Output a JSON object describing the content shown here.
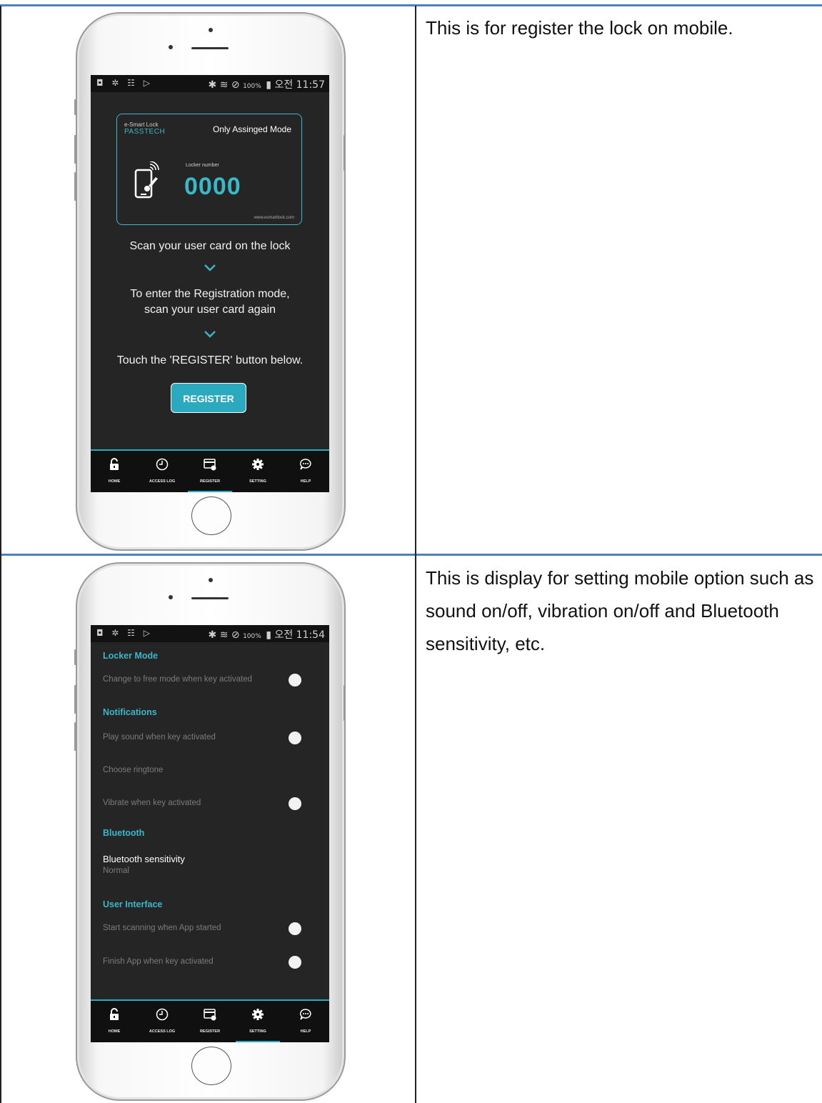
{
  "rows": [
    {
      "description": "This is for register the lock on mobile.",
      "screen": {
        "status": {
          "left_icons": "◘ ✲ ☷ ▷",
          "right_icons": "✱ ≋ ⊘",
          "battery": "100%",
          "time": "오전 11:57"
        },
        "card": {
          "brand_small": "e-Smart Lock",
          "brand_big": "PASSTECH",
          "mode_title": "Only Assinged Mode",
          "locker_label": "Locker number",
          "locker_number": "0000",
          "website": "www.esmartlock.com"
        },
        "instructions": {
          "step1": "Scan your user card on the lock",
          "step2_line1": "To enter the Registration mode,",
          "step2_line2": "scan your user card again",
          "step3": "Touch the 'REGISTER' button below."
        },
        "register_button": "REGISTER",
        "nav": [
          {
            "label": "HOME",
            "icon": "lock-icon"
          },
          {
            "label": "ACCESS LOG",
            "icon": "clock-icon"
          },
          {
            "label": "REGISTER",
            "icon": "card-icon",
            "active": true
          },
          {
            "label": "SETTING",
            "icon": "gear-icon"
          },
          {
            "label": "HELP",
            "icon": "chat-bubble-icon"
          }
        ]
      }
    },
    {
      "description": "This is display for setting mobile option such as sound on/off, vibration on/off and Bluetooth sensitivity, etc.",
      "screen": {
        "status": {
          "left_icons": "◘ ✲ ☷ ▷",
          "right_icons": "✱ ≋ ⊘",
          "battery": "100%",
          "time": "오전 11:54"
        },
        "settings": {
          "locker_mode_header": "Locker Mode",
          "free_mode_label": "Change to free mode when key activated",
          "notifications_header": "Notifications",
          "play_sound_label": "Play sound when key activated",
          "ringtone_label": "Choose ringtone",
          "vibrate_label": "Vibrate when key activated",
          "bluetooth_header": "Bluetooth",
          "bt_sensitivity_title": "Bluetooth sensitivity",
          "bt_sensitivity_value": "Normal",
          "ui_header": "User Interface",
          "start_scan_label": "Start scanning when App started",
          "finish_app_label": "Finish App when key activated"
        },
        "nav": [
          {
            "label": "HOME",
            "icon": "lock-icon"
          },
          {
            "label": "ACCESS LOG",
            "icon": "clock-icon"
          },
          {
            "label": "REGISTER",
            "icon": "card-icon"
          },
          {
            "label": "SETTING",
            "icon": "gear-icon",
            "active": true
          },
          {
            "label": "HELP",
            "icon": "chat-bubble-icon"
          }
        ]
      }
    }
  ],
  "colors": {
    "accent": "#3ab7c9",
    "table_border": "#4f81bd",
    "screen_bg": "#252525"
  }
}
